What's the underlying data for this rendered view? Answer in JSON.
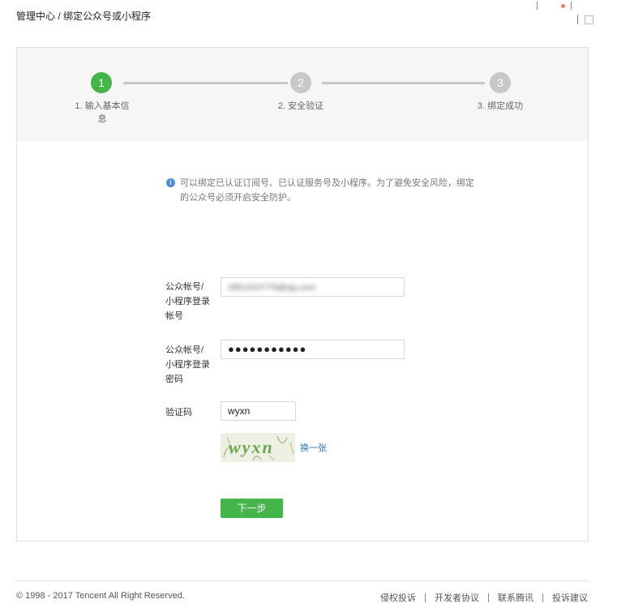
{
  "breadcrumb": "管理中心 / 绑定公众号或小程序",
  "steps": [
    {
      "number": "1",
      "label": "1. 输入基本信\n息",
      "active": true
    },
    {
      "number": "2",
      "label": "2. 安全验证",
      "active": false
    },
    {
      "number": "3",
      "label": "3. 绑定成功",
      "active": false
    }
  ],
  "notice": {
    "icon": "info-icon",
    "text": "可以绑定已认证订阅号、已认证服务号及小程序。为了避免安全风险，绑定的公众号必须开启安全防护。"
  },
  "form": {
    "account_label": "公众帐号/\n小程序登录\n帐号",
    "account_value": "2851915779@qq.com",
    "password_label": "公众帐号/\n小程序登录\n密码",
    "password_value": "●●●●●●●●●●●",
    "captcha_label": "验证码",
    "captcha_value": "wyxn",
    "captcha_image_text": "wyxn",
    "swap_label": "换一张",
    "next_label": "下一步"
  },
  "footer": {
    "copyright": "© 1998 - 2017 Tencent All Right Reserved.",
    "links": [
      "侵权投诉",
      "开发者协议",
      "联系腾讯",
      "投诉建议"
    ]
  },
  "colors": {
    "accent": "#44b549",
    "link": "#2a6fbe",
    "info": "#4a8fd8",
    "inactive_step": "#c8c8c8"
  }
}
